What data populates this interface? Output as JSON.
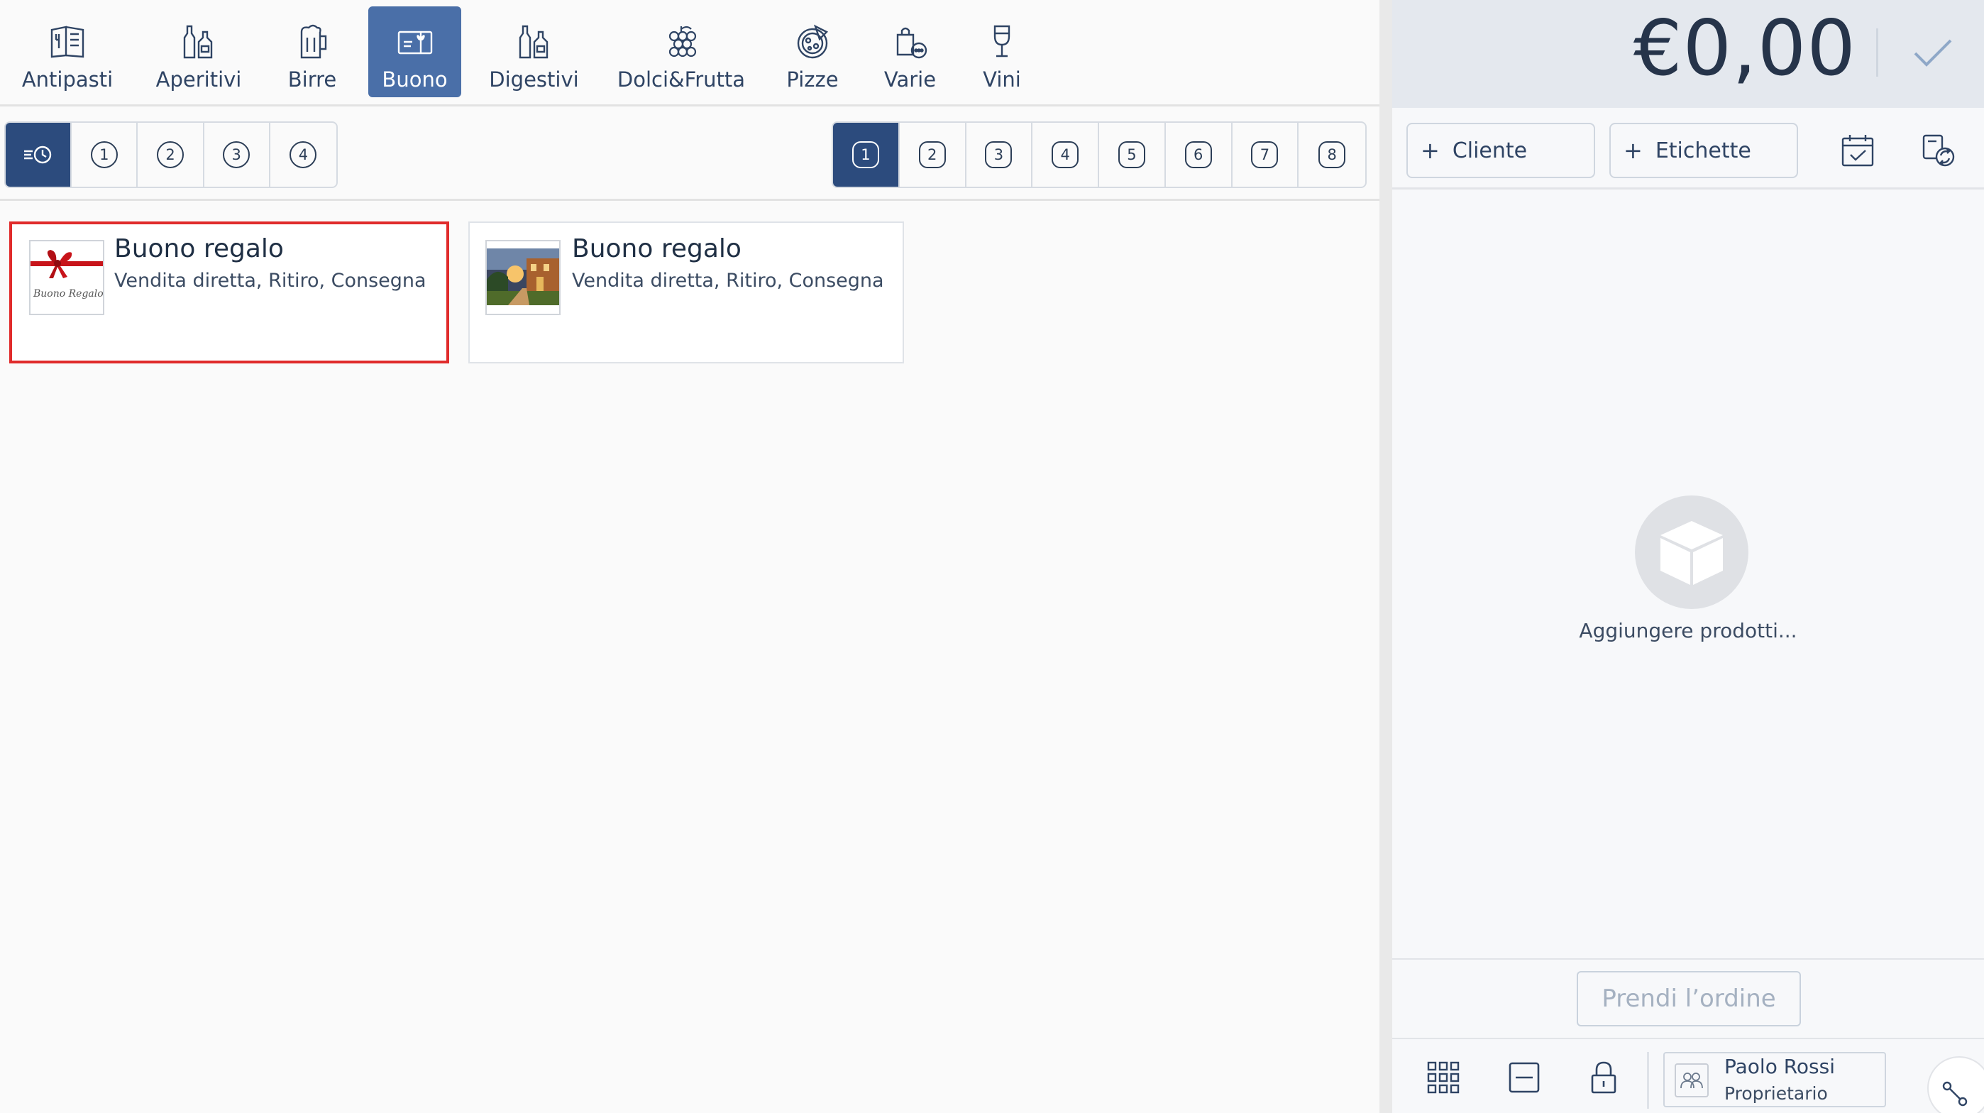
{
  "categories": [
    {
      "label": "Antipasti",
      "icon": "menu-book-icon"
    },
    {
      "label": "Aperitivi",
      "icon": "bottles-icon"
    },
    {
      "label": "Birre",
      "icon": "beer-mug-icon"
    },
    {
      "label": "Buono",
      "icon": "gift-card-icon",
      "active": true
    },
    {
      "label": "Digestivi",
      "icon": "bottles-icon"
    },
    {
      "label": "Dolci&Frutta",
      "icon": "grapes-icon"
    },
    {
      "label": "Pizze",
      "icon": "pizza-icon"
    },
    {
      "label": "Varie",
      "icon": "bag-icon"
    },
    {
      "label": "Vini",
      "icon": "wine-glass-icon"
    }
  ],
  "course_selector": [
    "1",
    "2",
    "3",
    "4"
  ],
  "page_selector": [
    "1",
    "2",
    "3",
    "4",
    "5",
    "6",
    "7",
    "8"
  ],
  "products": [
    {
      "title": "Buono regalo",
      "subtitle": "Vendita diretta, Ritiro, Consegna",
      "thumb_text": "Buono Regalo"
    },
    {
      "title": "Buono regalo",
      "subtitle": "Vendita diretta, Ritiro, Consegna"
    }
  ],
  "order": {
    "total": "€0,00",
    "customer_label": "Cliente",
    "tags_label": "Etichette",
    "empty_text": "Aggiungere prodotti...",
    "take_order_label": "Prendi l’ordine"
  },
  "user": {
    "name": "Paolo Rossi",
    "role": "Proprietario"
  },
  "colors": {
    "accent": "#4a6fa8",
    "accent_dark": "#2c4b7d",
    "selection": "#e02b2b"
  }
}
